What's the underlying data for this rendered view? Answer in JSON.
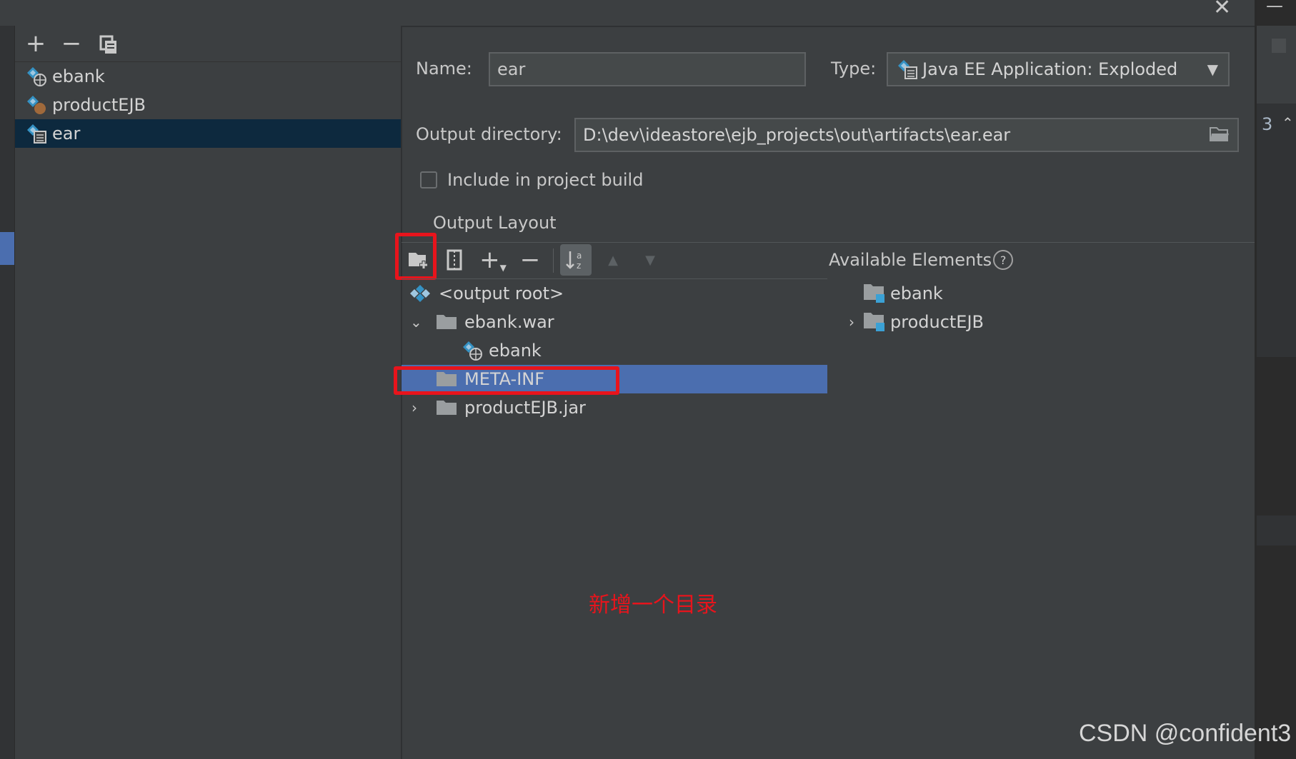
{
  "window": {
    "close_icon": "close-icon"
  },
  "left_toolbar": {
    "add": "+",
    "remove": "−",
    "copy_icon": "copy-icon"
  },
  "artifacts": [
    {
      "label": "ebank",
      "icon": "web-artifact-icon"
    },
    {
      "label": "productEJB",
      "icon": "ejb-artifact-icon"
    },
    {
      "label": "ear",
      "icon": "ear-artifact-icon",
      "selected": true
    }
  ],
  "form": {
    "name_label": "Name:",
    "name_value": "ear",
    "type_label": "Type:",
    "type_value": "Java EE Application: Exploded",
    "output_dir_label": "Output directory:",
    "output_dir_value": "D:\\dev\\ideastore\\ejb_projects\\out\\artifacts\\ear.ear",
    "include_label": "Include in project build",
    "include_checked": false
  },
  "output_layout": {
    "title": "Output Layout",
    "available_title": "Available Elements",
    "help": "?",
    "tree": [
      {
        "label": "<output root>",
        "level": 0,
        "icon": "root-icon"
      },
      {
        "label": "ebank.war",
        "level": 0,
        "icon": "folder-icon",
        "expanded": true
      },
      {
        "label": "ebank",
        "level": 1,
        "icon": "web-artifact-icon"
      },
      {
        "label": "META-INF",
        "level": 0,
        "icon": "folder-icon",
        "selected": true
      },
      {
        "label": "productEJB.jar",
        "level": 0,
        "icon": "folder-icon",
        "expanded": false
      }
    ],
    "available": [
      {
        "label": "ebank",
        "expandable": false
      },
      {
        "label": "productEJB",
        "expandable": true
      }
    ]
  },
  "annotation": "新增一个目录",
  "watermark": "CSDN @confident3",
  "editor_gutter": {
    "line_number": "3"
  },
  "colors": {
    "accent": "#4b6eaf",
    "highlight_red": "#e8141c",
    "bg": "#3c3f41"
  }
}
